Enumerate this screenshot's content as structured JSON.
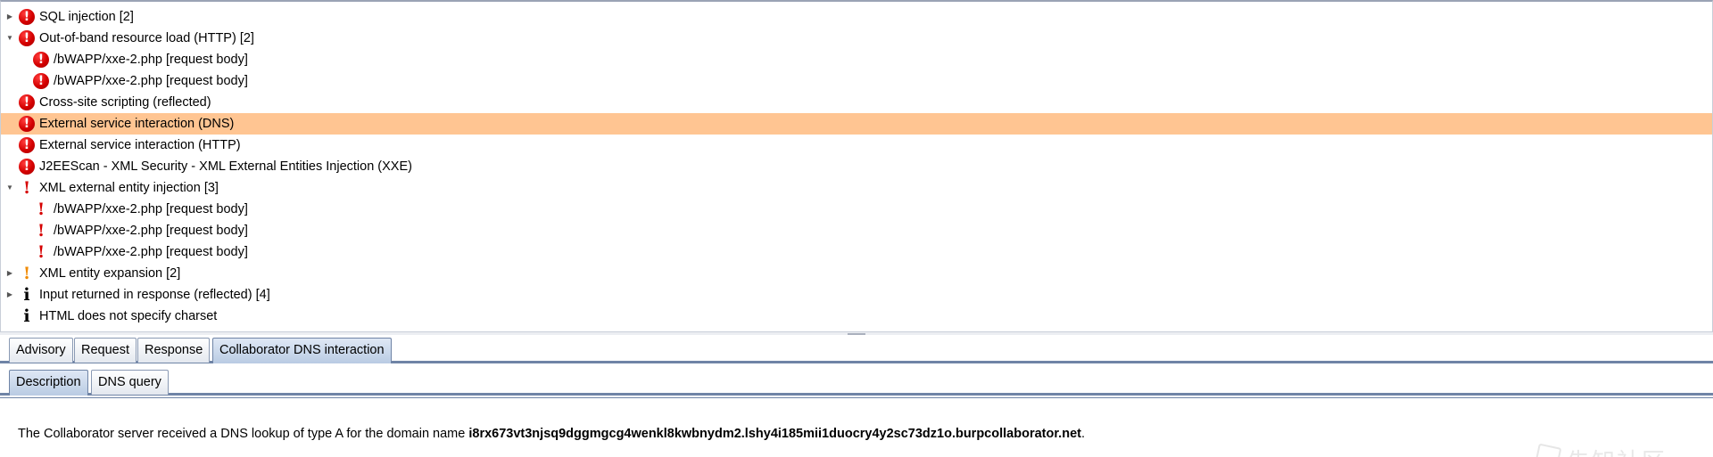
{
  "issues": [
    {
      "label": "SQL injection [2]",
      "severity": "high",
      "expander": "collapsed",
      "indent": 0
    },
    {
      "label": "Out-of-band resource load (HTTP) [2]",
      "severity": "high",
      "expander": "expanded",
      "indent": 0
    },
    {
      "label": "/bWAPP/xxe-2.php [request body]",
      "severity": "high",
      "expander": "none",
      "indent": 1
    },
    {
      "label": "/bWAPP/xxe-2.php [request body]",
      "severity": "high",
      "expander": "none",
      "indent": 1
    },
    {
      "label": "Cross-site scripting (reflected)",
      "severity": "high",
      "expander": "none",
      "indent": 0
    },
    {
      "label": "External service interaction (DNS)",
      "severity": "high",
      "expander": "none",
      "indent": 0,
      "selected": true
    },
    {
      "label": "External service interaction (HTTP)",
      "severity": "high",
      "expander": "none",
      "indent": 0
    },
    {
      "label": "J2EEScan - XML Security - XML External Entities Injection (XXE)",
      "severity": "high",
      "expander": "none",
      "indent": 0
    },
    {
      "label": "XML external entity injection [3]",
      "severity": "medium",
      "expander": "expanded",
      "indent": 0
    },
    {
      "label": "/bWAPP/xxe-2.php [request body]",
      "severity": "medium",
      "expander": "none",
      "indent": 1
    },
    {
      "label": "/bWAPP/xxe-2.php [request body]",
      "severity": "medium",
      "expander": "none",
      "indent": 1
    },
    {
      "label": "/bWAPP/xxe-2.php [request body]",
      "severity": "medium",
      "expander": "none",
      "indent": 1
    },
    {
      "label": "XML entity expansion [2]",
      "severity": "low",
      "expander": "collapsed",
      "indent": 0
    },
    {
      "label": "Input returned in response (reflected) [4]",
      "severity": "info",
      "expander": "collapsed",
      "indent": 0
    },
    {
      "label": "HTML does not specify charset",
      "severity": "info",
      "expander": "none",
      "indent": 0
    }
  ],
  "icons": {
    "expanded": "▼",
    "collapsed": "▶",
    "high": "!",
    "medium": "!",
    "low": "!",
    "info": "i"
  },
  "colors": {
    "selected_row": "#ffc592",
    "high": "#d40000",
    "medium": "#d60000",
    "low": "#f08a00",
    "tab_active": "#b9cbe3"
  },
  "primary_tabs": {
    "advisory": "Advisory",
    "request": "Request",
    "response": "Response",
    "collaborator": "Collaborator DNS interaction",
    "active": "collaborator"
  },
  "secondary_tabs": {
    "description": "Description",
    "dns_query": "DNS query",
    "active": "description"
  },
  "description": {
    "prefix": "The Collaborator server received a DNS lookup of type A for the domain name ",
    "domain": "i8rx673vt3njsq9dggmgcg4wenkl8kwbnydm2.lshy4i185mii1duocry4y2sc73dz1o.burpcollaborator.net",
    "suffix": "."
  },
  "watermark": {
    "text": "先知社区"
  }
}
